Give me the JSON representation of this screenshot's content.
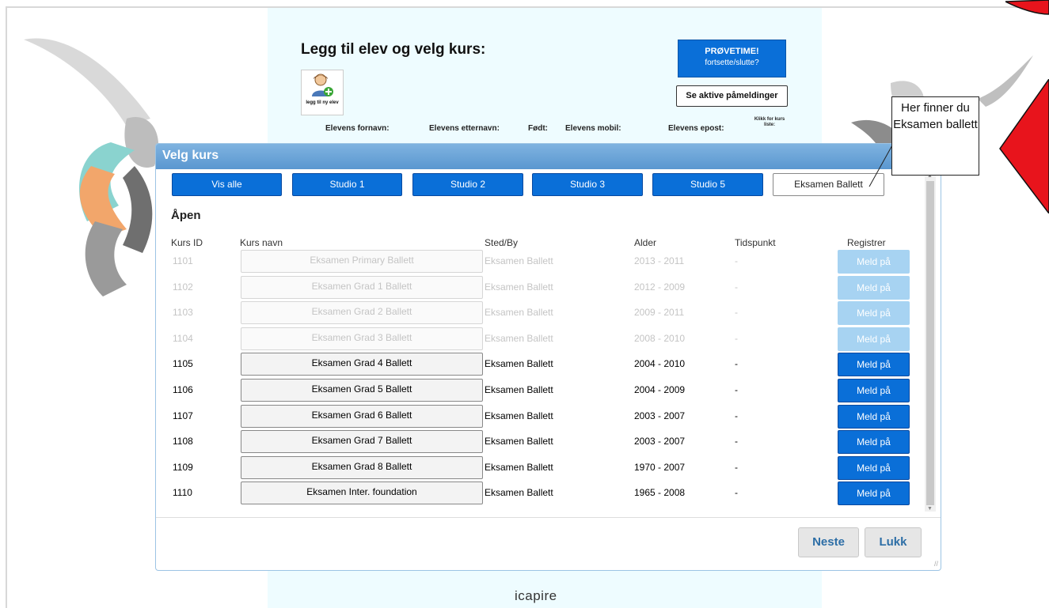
{
  "page": {
    "title": "Legg til elev og velg kurs:",
    "brand": "icapire"
  },
  "add_student": {
    "label": "legg til ny elev"
  },
  "buttons": {
    "trial_line1": "PRØVETIME!",
    "trial_line2": "fortsette/slutte?",
    "active_registrations": "Se aktive påmeldinger"
  },
  "student_fields": {
    "first_name": "Elevens fornavn:",
    "last_name": "Elevens etternavn:",
    "born": "Født:",
    "mobile": "Elevens mobil:",
    "email": "Elevens epost:",
    "course_list_hint": "Klikk for kurs liste:"
  },
  "dialog": {
    "title": "Velg kurs",
    "tabs": [
      "Vis alle",
      "Studio 1",
      "Studio 2",
      "Studio 3",
      "Studio 5",
      "Eksamen Ballett"
    ],
    "section": "Åpen",
    "columns": {
      "id": "Kurs ID",
      "name": "Kurs navn",
      "place": "Sted/By",
      "age": "Alder",
      "time": "Tidspunkt",
      "register": "Registrer"
    },
    "rows": [
      {
        "id": "1101",
        "name": "Eksamen Primary Ballett",
        "place": "Eksamen Ballett",
        "age": "2013 - 2011",
        "time": "-",
        "action": "Meld på",
        "enabled": false
      },
      {
        "id": "1102",
        "name": "Eksamen Grad 1 Ballett",
        "place": "Eksamen Ballett",
        "age": "2012 - 2009",
        "time": "-",
        "action": "Meld på",
        "enabled": false
      },
      {
        "id": "1103",
        "name": "Eksamen Grad 2 Ballett",
        "place": "Eksamen Ballett",
        "age": "2009 - 2011",
        "time": "-",
        "action": "Meld på",
        "enabled": false
      },
      {
        "id": "1104",
        "name": "Eksamen Grad 3 Ballett",
        "place": "Eksamen Ballett",
        "age": "2008 - 2010",
        "time": "-",
        "action": "Meld på",
        "enabled": false
      },
      {
        "id": "1105",
        "name": "Eksamen Grad 4 Ballett",
        "place": "Eksamen Ballett",
        "age": "2004 - 2010",
        "time": "-",
        "action": "Meld på",
        "enabled": true
      },
      {
        "id": "1106",
        "name": "Eksamen Grad 5 Ballett",
        "place": "Eksamen Ballett",
        "age": "2004 - 2009",
        "time": "-",
        "action": "Meld på",
        "enabled": true
      },
      {
        "id": "1107",
        "name": "Eksamen Grad 6 Ballett",
        "place": "Eksamen Ballett",
        "age": "2003 - 2007",
        "time": "-",
        "action": "Meld på",
        "enabled": true
      },
      {
        "id": "1108",
        "name": "Eksamen Grad 7 Ballett",
        "place": "Eksamen Ballett",
        "age": "2003 - 2007",
        "time": "-",
        "action": "Meld på",
        "enabled": true
      },
      {
        "id": "1109",
        "name": "Eksamen Grad 8 Ballett",
        "place": "Eksamen Ballett",
        "age": "1970 - 2007",
        "time": "-",
        "action": "Meld på",
        "enabled": true
      },
      {
        "id": "1110",
        "name": "Eksamen Inter. foundation",
        "place": "Eksamen Ballett",
        "age": "1965 - 2008",
        "time": "-",
        "action": "Meld på",
        "enabled": true
      }
    ],
    "next": "Neste",
    "close": "Lukk"
  },
  "annotation": {
    "text": "Her finner du Eksamen ballett",
    "arrow_color": "#e8141c"
  },
  "colors": {
    "primary_blue": "#0a6fd8",
    "disabled_blue": "#a7d3f2",
    "header_blue": "#5a97d0"
  }
}
